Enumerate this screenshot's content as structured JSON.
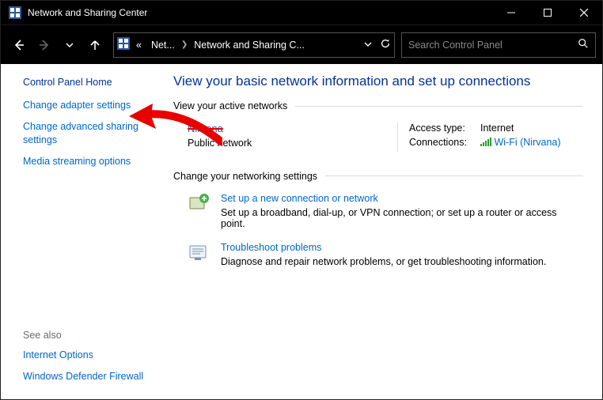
{
  "window": {
    "title": "Network and Sharing Center"
  },
  "breadcrumb": {
    "prefix": "«",
    "c1": "Net...",
    "c2": "Network and Sharing C..."
  },
  "search": {
    "placeholder": "Search Control Panel"
  },
  "sidebar": {
    "home": "Control Panel Home",
    "links": {
      "adapter": "Change adapter settings",
      "advanced": "Change advanced sharing settings",
      "media": "Media streaming options"
    },
    "seealso_label": "See also",
    "seealso": {
      "internet": "Internet Options",
      "firewall": "Windows Defender Firewall"
    }
  },
  "main": {
    "heading": "View your basic network information and set up connections",
    "active_label": "View your active networks",
    "network": {
      "name": "Nirvana",
      "type": "Public network",
      "access_k": "Access type:",
      "access_v": "Internet",
      "conn_k": "Connections:",
      "conn_v": "Wi-Fi (Nirvana)"
    },
    "change_label": "Change your networking settings",
    "setup": {
      "title": "Set up a new connection or network",
      "desc": "Set up a broadband, dial-up, or VPN connection; or set up a router or access point."
    },
    "troubleshoot": {
      "title": "Troubleshoot problems",
      "desc": "Diagnose and repair network problems, or get troubleshooting information."
    }
  }
}
